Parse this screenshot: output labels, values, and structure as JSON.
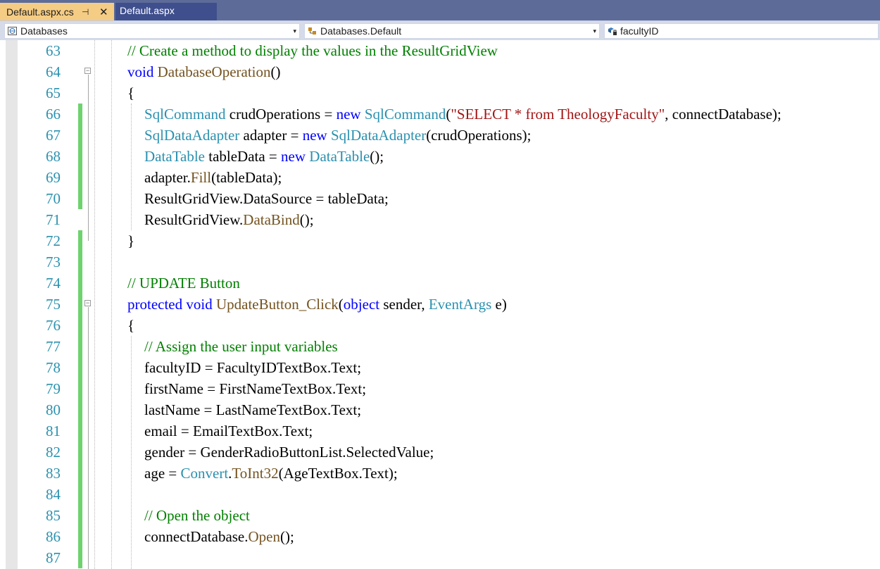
{
  "tabs": {
    "active": {
      "label": "Default.aspx.cs",
      "pin": "⊣",
      "close": "✕"
    },
    "inactive": {
      "label": "Default.aspx"
    }
  },
  "navbar": {
    "project_combo": "Databases",
    "type_combo": "Databases.Default",
    "member_combo": "facultyID",
    "dropdown_arrow": "▾"
  },
  "colors": {
    "tab_active": "#f5cc84",
    "tab_inactive": "#3f4f8d",
    "tabbar_bg": "#5d6b99",
    "change_marker": "#6fd26f",
    "line_number": "#2b91af",
    "comment": "#008000",
    "keyword": "#0000ff",
    "type": "#2b91af",
    "method": "#74531f",
    "string": "#a31515"
  },
  "code_lines": [
    {
      "num": "63",
      "tokens": [
        [
          "cm",
          "// Create a method to display the values in the ResultGridView"
        ]
      ]
    },
    {
      "num": "64",
      "tokens": [
        [
          "kw",
          "void"
        ],
        [
          "p",
          " "
        ],
        [
          "mt",
          "DatabaseOperation"
        ],
        [
          "p",
          "()"
        ]
      ]
    },
    {
      "num": "65",
      "tokens": [
        [
          "p",
          "{"
        ]
      ]
    },
    {
      "num": "66",
      "tokens": [
        [
          "ty",
          "SqlCommand"
        ],
        [
          "p",
          " crudOperations = "
        ],
        [
          "kw",
          "new"
        ],
        [
          "p",
          " "
        ],
        [
          "ty",
          "SqlCommand"
        ],
        [
          "p",
          "("
        ],
        [
          "str",
          "\"SELECT * from TheologyFaculty\""
        ],
        [
          "p",
          ", connectDatabase);"
        ]
      ]
    },
    {
      "num": "67",
      "tokens": [
        [
          "ty",
          "SqlDataAdapter"
        ],
        [
          "p",
          " adapter = "
        ],
        [
          "kw",
          "new"
        ],
        [
          "p",
          " "
        ],
        [
          "ty",
          "SqlDataAdapter"
        ],
        [
          "p",
          "(crudOperations);"
        ]
      ]
    },
    {
      "num": "68",
      "tokens": [
        [
          "ty",
          "DataTable"
        ],
        [
          "p",
          " tableData = "
        ],
        [
          "kw",
          "new"
        ],
        [
          "p",
          " "
        ],
        [
          "ty",
          "DataTable"
        ],
        [
          "p",
          "();"
        ]
      ]
    },
    {
      "num": "69",
      "tokens": [
        [
          "p",
          "adapter."
        ],
        [
          "mt",
          "Fill"
        ],
        [
          "p",
          "(tableData);"
        ]
      ]
    },
    {
      "num": "70",
      "tokens": [
        [
          "p",
          "ResultGridView.DataSource = tableData;"
        ]
      ]
    },
    {
      "num": "71",
      "tokens": [
        [
          "p",
          "ResultGridView."
        ],
        [
          "mt",
          "DataBind"
        ],
        [
          "p",
          "();"
        ]
      ]
    },
    {
      "num": "72",
      "tokens": [
        [
          "p",
          "}"
        ]
      ]
    },
    {
      "num": "73",
      "tokens": []
    },
    {
      "num": "74",
      "tokens": [
        [
          "cm",
          "// UPDATE Button"
        ]
      ]
    },
    {
      "num": "75",
      "tokens": [
        [
          "kw",
          "protected"
        ],
        [
          "p",
          " "
        ],
        [
          "kw",
          "void"
        ],
        [
          "p",
          " "
        ],
        [
          "mt",
          "UpdateButton_Click"
        ],
        [
          "p",
          "("
        ],
        [
          "kw",
          "object"
        ],
        [
          "p",
          " sender, "
        ],
        [
          "ty",
          "EventArgs"
        ],
        [
          "p",
          " e)"
        ]
      ]
    },
    {
      "num": "76",
      "tokens": [
        [
          "p",
          "{"
        ]
      ]
    },
    {
      "num": "77",
      "tokens": [
        [
          "cm",
          "// Assign the user input variables"
        ]
      ]
    },
    {
      "num": "78",
      "tokens": [
        [
          "p",
          "facultyID = FacultyIDTextBox.Text;"
        ]
      ]
    },
    {
      "num": "79",
      "tokens": [
        [
          "p",
          "firstName = FirstNameTextBox.Text;"
        ]
      ]
    },
    {
      "num": "80",
      "tokens": [
        [
          "p",
          "lastName = LastNameTextBox.Text;"
        ]
      ]
    },
    {
      "num": "81",
      "tokens": [
        [
          "p",
          "email = EmailTextBox.Text;"
        ]
      ]
    },
    {
      "num": "82",
      "tokens": [
        [
          "p",
          "gender = GenderRadioButtonList.SelectedValue;"
        ]
      ]
    },
    {
      "num": "83",
      "tokens": [
        [
          "p",
          "age = "
        ],
        [
          "ty",
          "Convert"
        ],
        [
          "p",
          "."
        ],
        [
          "mt",
          "ToInt32"
        ],
        [
          "p",
          "(AgeTextBox.Text);"
        ]
      ]
    },
    {
      "num": "84",
      "tokens": []
    },
    {
      "num": "85",
      "tokens": [
        [
          "cm",
          "// Open the object"
        ]
      ]
    },
    {
      "num": "86",
      "tokens": [
        [
          "p",
          "connectDatabase."
        ],
        [
          "mt",
          "Open"
        ],
        [
          "p",
          "();"
        ]
      ]
    },
    {
      "num": "87",
      "tokens": []
    }
  ]
}
